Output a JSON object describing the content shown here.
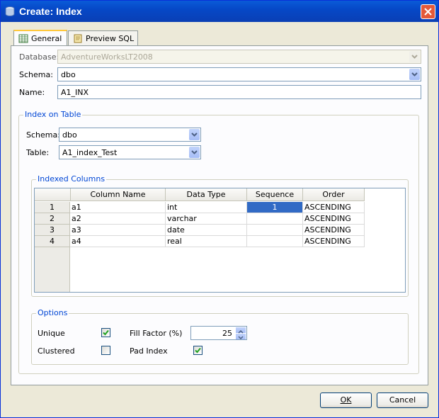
{
  "window": {
    "title": "Create: Index"
  },
  "tabs": [
    {
      "label": "General"
    },
    {
      "label": "Preview SQL"
    }
  ],
  "form": {
    "database_label": "Database:",
    "database_value": "AdventureWorksLT2008",
    "schema_label": "Schema:",
    "schema_value": "dbo",
    "name_label": "Name:",
    "name_value": "A1_INX"
  },
  "index_on_table": {
    "title": "Index on Table",
    "schema_label": "Schema:",
    "schema_value": "dbo",
    "table_label": "Table:",
    "table_value": "A1_index_Test"
  },
  "indexed_columns": {
    "title": "Indexed Columns",
    "headers": [
      "Column Name",
      "Data Type",
      "Sequence",
      "Order"
    ],
    "rows": [
      {
        "num": "1",
        "name": "a1",
        "type": "int",
        "seq": "1",
        "order": "ASCENDING"
      },
      {
        "num": "2",
        "name": "a2",
        "type": "varchar",
        "seq": "",
        "order": "ASCENDING"
      },
      {
        "num": "3",
        "name": "a3",
        "type": "date",
        "seq": "",
        "order": "ASCENDING"
      },
      {
        "num": "4",
        "name": "a4",
        "type": "real",
        "seq": "",
        "order": "ASCENDING"
      }
    ]
  },
  "options": {
    "title": "Options",
    "unique_label": "Unique",
    "unique_checked": true,
    "clustered_label": "Clustered",
    "clustered_checked": false,
    "fill_factor_label": "Fill Factor (%)",
    "fill_factor_value": "25",
    "pad_index_label": "Pad Index",
    "pad_index_checked": true
  },
  "buttons": {
    "ok": "OK",
    "cancel": "Cancel"
  },
  "colors": {
    "titlebar": "#0648c7",
    "group_title": "#0046d5",
    "selection": "#316ac5",
    "close": "#e45a3a"
  }
}
